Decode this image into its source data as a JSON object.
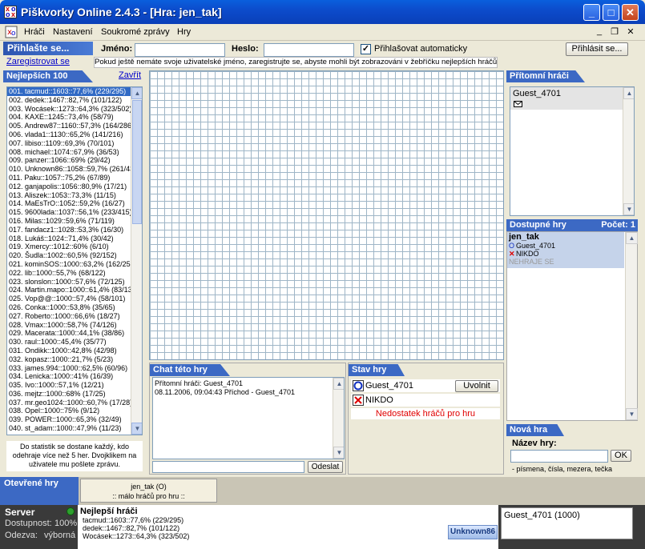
{
  "window": {
    "title": "Piškvorky Online 2.4.3 - [Hra: jen_tak]"
  },
  "menu": {
    "items": [
      "Hráči",
      "Nastavení",
      "Soukromé zprávy",
      "Hry"
    ]
  },
  "login": {
    "header": "Přihlašte se...",
    "register_link": "Zaregistrovat se",
    "name_label": "Jméno:",
    "name_value": "",
    "password_label": "Heslo:",
    "password_value": "",
    "auto_login_label": "Přihlašovat automaticky",
    "auto_login_checked": true,
    "login_button": "Přihlásit se...",
    "info": "Pokud ještě nemáte svoje uživatelské jméno, zaregistrujte se, abyste mohli být zobrazováni v žebříčku nejlepších hráčů!"
  },
  "top100": {
    "header": "Nejlepších 100",
    "close_link": "Zavřít",
    "rows": [
      "001. tacmud::1603::77,6% (229/295)",
      "002. dedek::1467::82,7% (101/122)",
      "003. Wocásek::1273::64,3% (323/502)",
      "004. KAXE::1245::73,4% (58/79)",
      "005. Andrew87::1160::57,3% (164/286)",
      "006. vlada1::1130::65,2% (141/216)",
      "007. libiso::1109::69,3% (70/101)",
      "008. michael::1074::67,9% (36/53)",
      "009. panzer::1066::69% (29/42)",
      "010. Unknown86::1058::59,7% (261/437)",
      "011. Paku::1057::75,2% (67/89)",
      "012. ganjapolis::1056::80,9% (17/21)",
      "013. Aliszek::1053::73,3% (11/15)",
      "014. MaEsTrO::1052::59,2% (16/27)",
      "015. 9600lada::1037::56,1% (233/415)",
      "016. Milas::1029::59,6% (71/119)",
      "017. fandacz1::1028::53,3% (16/30)",
      "018. Lukáš::1024::71,4% (30/42)",
      "019. Xmercy::1012::60% (6/10)",
      "020. Šudla::1002::60,5% (92/152)",
      "021. kominSOS::1000::63,2% (162/256)",
      "022. lib::1000::55,7% (68/122)",
      "023. slonslon::1000::57,6% (72/125)",
      "024. Martin.mapo::1000::61,4% (83/135)",
      "025. Vop@@::1000::57,4% (58/101)",
      "026. Conka::1000::53,8% (35/65)",
      "027. Roberto::1000::66,6% (18/27)",
      "028. Vmax::1000::58,7% (74/126)",
      "029. Macerata::1000::44,1% (38/86)",
      "030. raul::1000::45,4% (35/77)",
      "031. Ondikk::1000::42,8% (42/98)",
      "032. kopasz::1000::21,7% (5/23)",
      "033. james.994::1000::62,5% (60/96)",
      "034. Lenicka::1000::41% (16/39)",
      "035. Ivo::1000::57,1% (12/21)",
      "036. mejtz::1000::68% (17/25)",
      "037. mr.geo1024::1000::60,7% (17/28)",
      "038. Opel::1000::75% (9/12)",
      "039. POWER::1000::65,3% (32/49)",
      "040. st_adam::1000::47,9% (11/23)"
    ],
    "note": "Do statistik se dostane každý, kdo odehraje více než 5 her. Dvojklikem na uživatele mu pošlete zprávu."
  },
  "present_players": {
    "header": "Přítomní hráči",
    "players": [
      "Guest_4701"
    ]
  },
  "available_games": {
    "header": "Dostupné hry",
    "count_label": "Počet: 1",
    "game_name": "jen_tak",
    "player_o": "Guest_4701",
    "player_x": "NIKDO",
    "status": "NEHRAJE SE"
  },
  "new_game": {
    "header": "Nová hra",
    "name_label": "Název hry:",
    "ok_button": "OK",
    "hint": "- písmena, čísla, mezera, tečka"
  },
  "chat": {
    "header": "Chat této hry",
    "lines": [
      "Přítomní hráči: Guest_4701",
      "08.11.2006, 09:04:43 Příchod - Guest_4701"
    ],
    "send_button": "Odeslat"
  },
  "game_status": {
    "header": "Stav hry",
    "player_o": "Guest_4701",
    "release_button": "Uvolnit",
    "player_x": "NIKDO",
    "warning": "Nedostatek hráčů pro hru"
  },
  "open_games": {
    "header": "Otevřené hry",
    "card_title": "jen_tak (O)",
    "card_subtitle": ":: málo hráčů pro hru ::"
  },
  "server": {
    "title": "Server",
    "availability_label": "Dostupnost:",
    "availability_value": "100%",
    "response_label": "Odezva:",
    "response_value": "výborná",
    "best_title": "Nejlepší hráči",
    "best_rows": [
      "tacmud::1603::77,6% (229/295)",
      "dedek::1467::82,7% (101/122)",
      "Wocásek::1273::64,3% (323/502)"
    ],
    "logo_text": "Unknown86",
    "user_box": "Guest_4701 (1000)"
  },
  "colors": {
    "accent": "#3c69c4",
    "title_bar": "#0a5fdd",
    "warning": "#e00000",
    "status_bg": "#3a3a3a"
  }
}
